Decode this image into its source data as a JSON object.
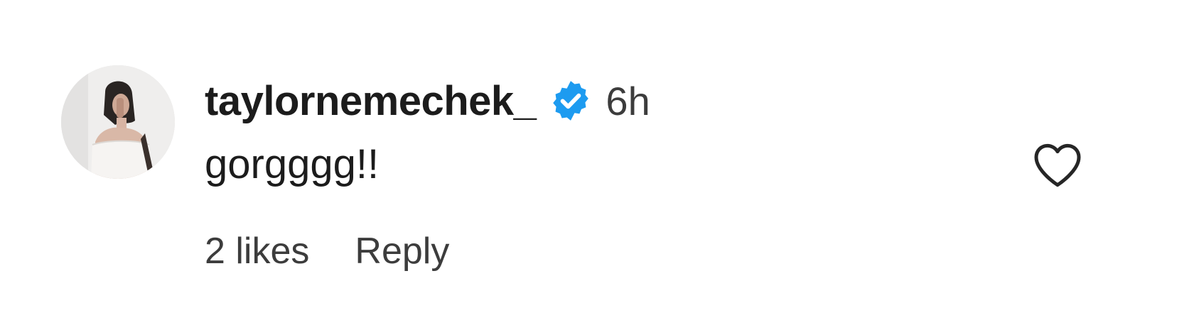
{
  "comment": {
    "username": "taylornemechek_",
    "verified": true,
    "time": "6h",
    "text": "gorgggg!!",
    "likes_label": "2 likes",
    "reply_label": "Reply"
  },
  "icons": {
    "verified": "verified-badge-icon",
    "like": "heart-outline-icon"
  },
  "colors": {
    "verified_badge": "#1d9bf0",
    "text_primary": "#1c1c1c",
    "text_secondary": "#3c3c3c"
  }
}
